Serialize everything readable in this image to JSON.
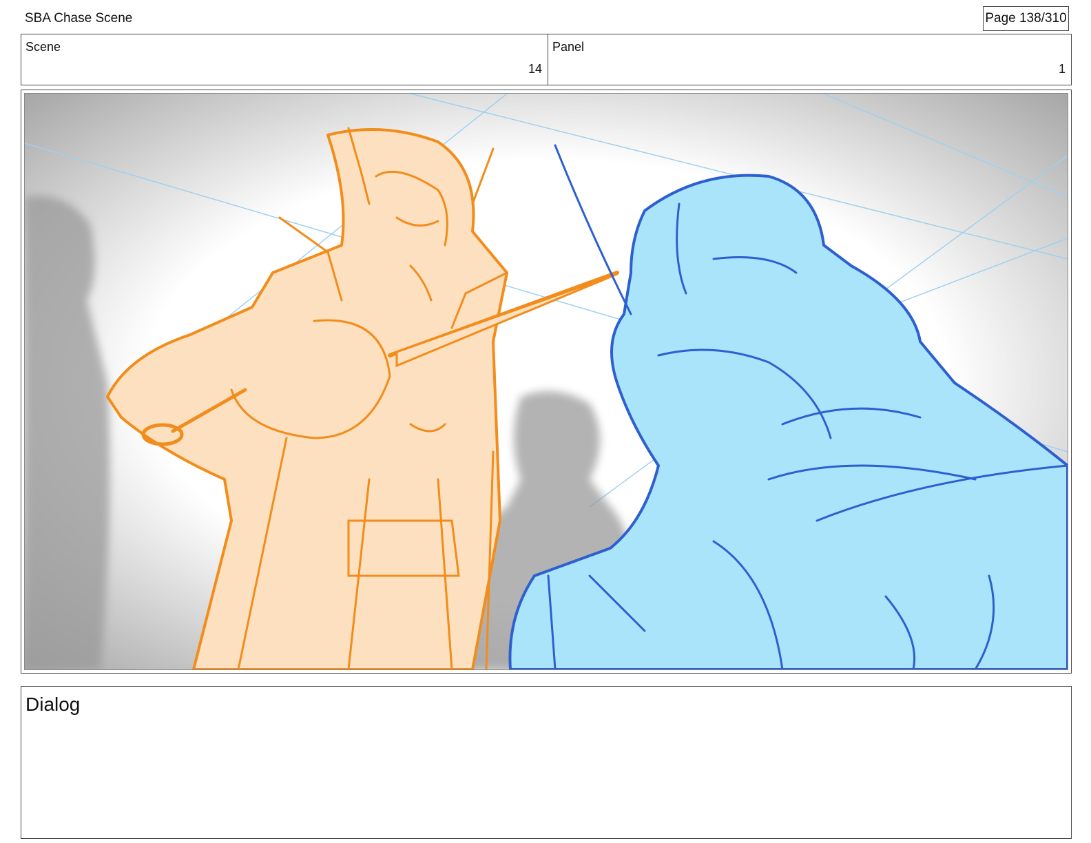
{
  "header": {
    "project_title": "SBA Chase Scene",
    "page_label": "Page 138/310"
  },
  "info": {
    "scene_label": "Scene",
    "scene_value": "14",
    "panel_label": "Panel",
    "panel_value": "1"
  },
  "frame": {
    "image_semantic": "storyboard-sketch-sword-fight",
    "colors": {
      "orange_character_fill": "#fde0c0",
      "orange_character_line": "#f28c1a",
      "blue_character_fill": "#a9e4fa",
      "blue_character_line": "#2d5fd0",
      "background_figure": "#9a9a9a",
      "perspective_lines": "#9fd0ef"
    }
  },
  "dialog": {
    "label": "Dialog",
    "text": ""
  }
}
